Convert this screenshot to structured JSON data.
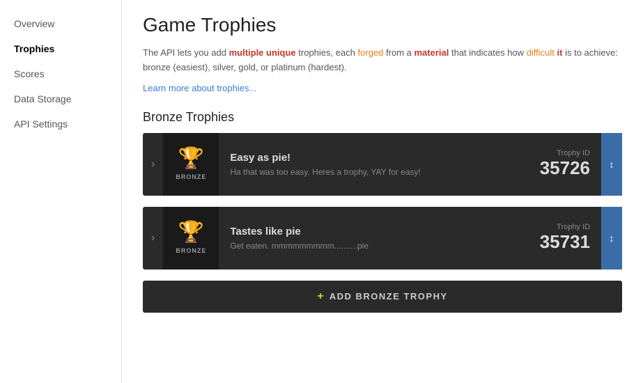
{
  "sidebar": {
    "items": [
      {
        "id": "overview",
        "label": "Overview",
        "active": false
      },
      {
        "id": "trophies",
        "label": "Trophies",
        "active": true
      },
      {
        "id": "scores",
        "label": "Scores",
        "active": false
      },
      {
        "id": "data-storage",
        "label": "Data Storage",
        "active": false
      },
      {
        "id": "api-settings",
        "label": "API Settings",
        "active": false
      }
    ]
  },
  "main": {
    "page_title": "Game Trophies",
    "description_plain": "The API lets you add multiple unique trophies, each forged from a material that indicates how difficult it is to achieve: bronze (easiest), silver, gold, or platinum (hardest).",
    "learn_more_label": "Learn more about trophies...",
    "section_title": "Bronze Trophies",
    "trophies": [
      {
        "id": "trophy-1",
        "name": "Easy as pie!",
        "description": "Ha that was too easy. Heres a trophy, YAY for easy!",
        "material": "BRONZE",
        "trophy_id_label": "Trophy ID",
        "trophy_id_value": "35726",
        "icon": "🏆"
      },
      {
        "id": "trophy-2",
        "name": "Tastes like pie",
        "description": "Get eaten. mmmmmmmmm..........pie",
        "material": "BRONZE",
        "trophy_id_label": "Trophy ID",
        "trophy_id_value": "35731",
        "icon": "🏆"
      }
    ],
    "add_button": {
      "plus": "+",
      "label": "ADD BRONZE TROPHY"
    }
  }
}
